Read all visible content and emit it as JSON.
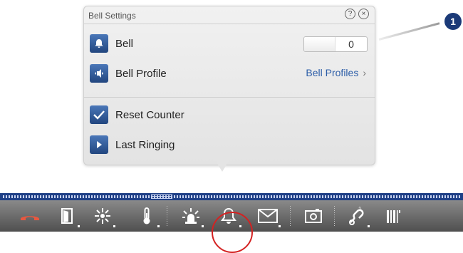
{
  "popup": {
    "title": "Bell Settings",
    "help_icon": "question-circle-icon",
    "close_icon": "close-circle-icon",
    "rows": {
      "bell": {
        "label": "Bell",
        "icon": "bell-icon",
        "value": "0"
      },
      "profile": {
        "label": "Bell Profile",
        "icon": "speaker-arrows-icon",
        "link": "Bell Profiles"
      },
      "reset": {
        "label": "Reset Counter",
        "icon": "checkmark-icon"
      },
      "last": {
        "label": "Last Ringing",
        "icon": "play-icon"
      }
    }
  },
  "callout": {
    "number": "1"
  },
  "toolbar": {
    "items": [
      "hang-up-icon",
      "door-icon",
      "brightness-icon",
      "thermometer-icon",
      "alarm-light-icon",
      "bell-icon",
      "mail-icon",
      "camera-icon",
      "link-icon",
      "barcode-icon"
    ]
  },
  "colors": {
    "accent": "#1e3f86",
    "link": "#2d5ea8",
    "highlight": "#d42222",
    "hangup": "#e8573f"
  }
}
